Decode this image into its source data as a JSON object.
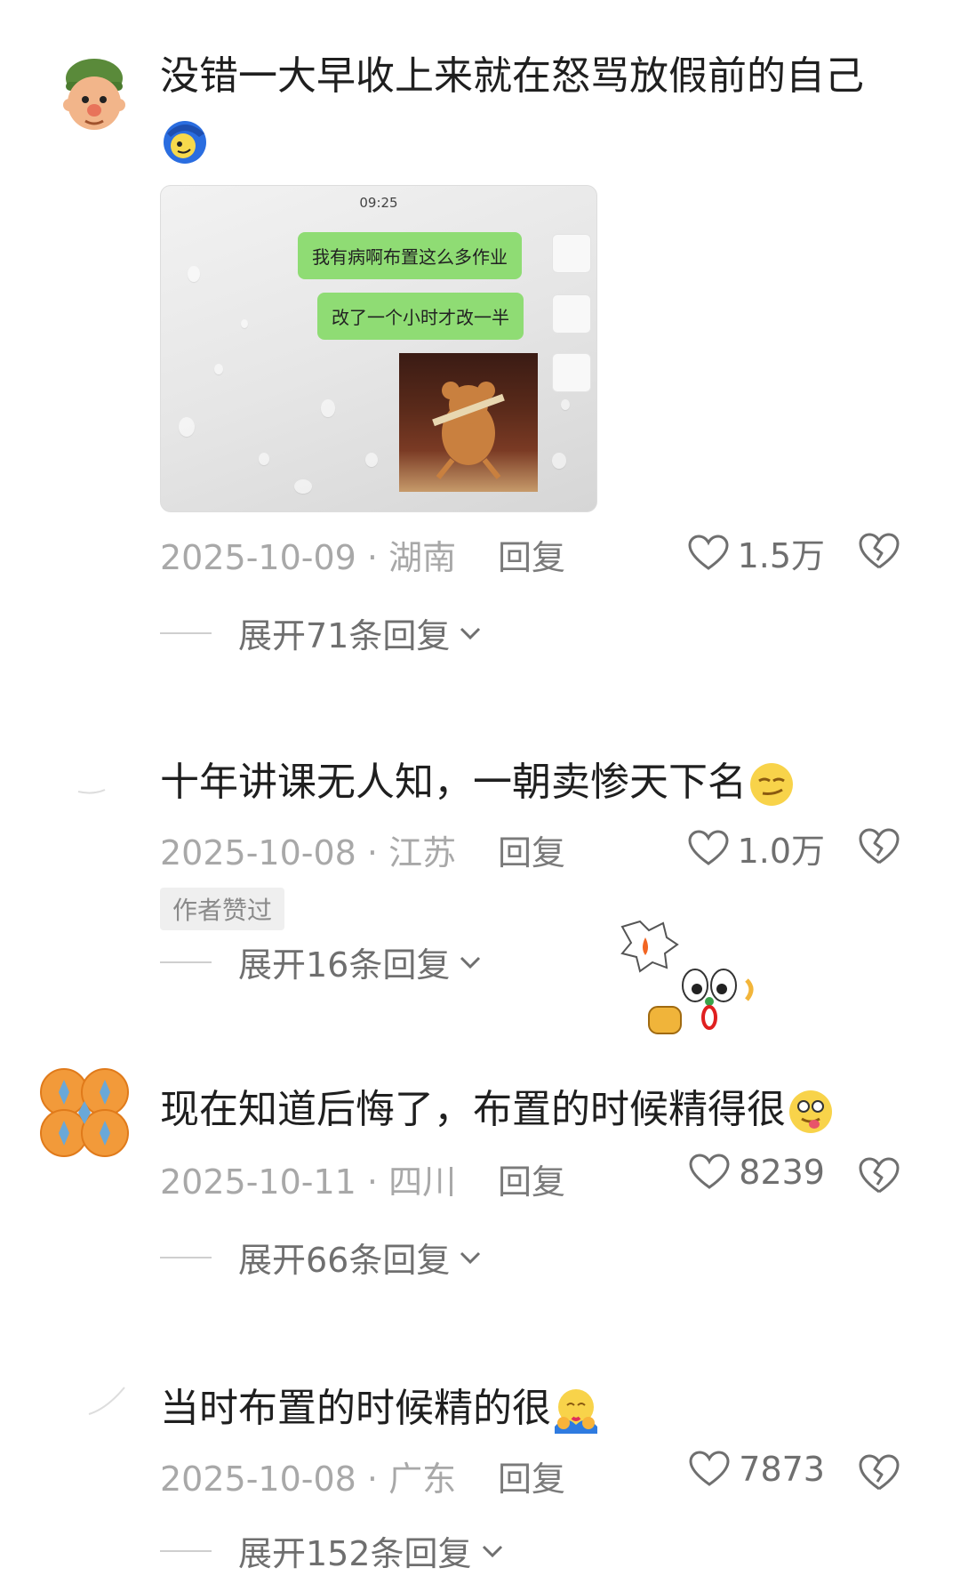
{
  "comments": [
    {
      "text": "没错一大早收上来就在怒骂放假前的自己",
      "date": "2025-10-09",
      "region": "湖南",
      "reply_label": "回复",
      "likes": "1.5万",
      "expand_text": "展开71条回复"
    },
    {
      "text": "十年讲课无人知，一朝卖惨天下名",
      "date": "2025-10-08",
      "region": "江苏",
      "reply_label": "回复",
      "likes": "1.0万",
      "badge": "作者赞过",
      "expand_text": "展开16条回复"
    },
    {
      "text": "现在知道后悔了，布置的时候精得很",
      "date": "2025-10-11",
      "region": "四川",
      "reply_label": "回复",
      "likes": "8239",
      "expand_text": "展开66条回复"
    },
    {
      "text": "当时布置的时候精的很",
      "date": "2025-10-08",
      "region": "广东",
      "reply_label": "回复",
      "likes": "7873",
      "expand_text": "展开152条回复"
    }
  ],
  "chat_screenshot": {
    "time": "09:25",
    "messages": [
      "我有病啊布置这么多作业",
      "改了一个小时才改一半"
    ]
  },
  "separator": " · ",
  "icons": {
    "like": "heart-outline-icon",
    "dislike": "broken-heart-icon",
    "expand": "chevron-down-icon"
  },
  "colors": {
    "bubble": "#8fdc74",
    "meta": "#a8a8a8",
    "badge_bg": "#efefef"
  }
}
